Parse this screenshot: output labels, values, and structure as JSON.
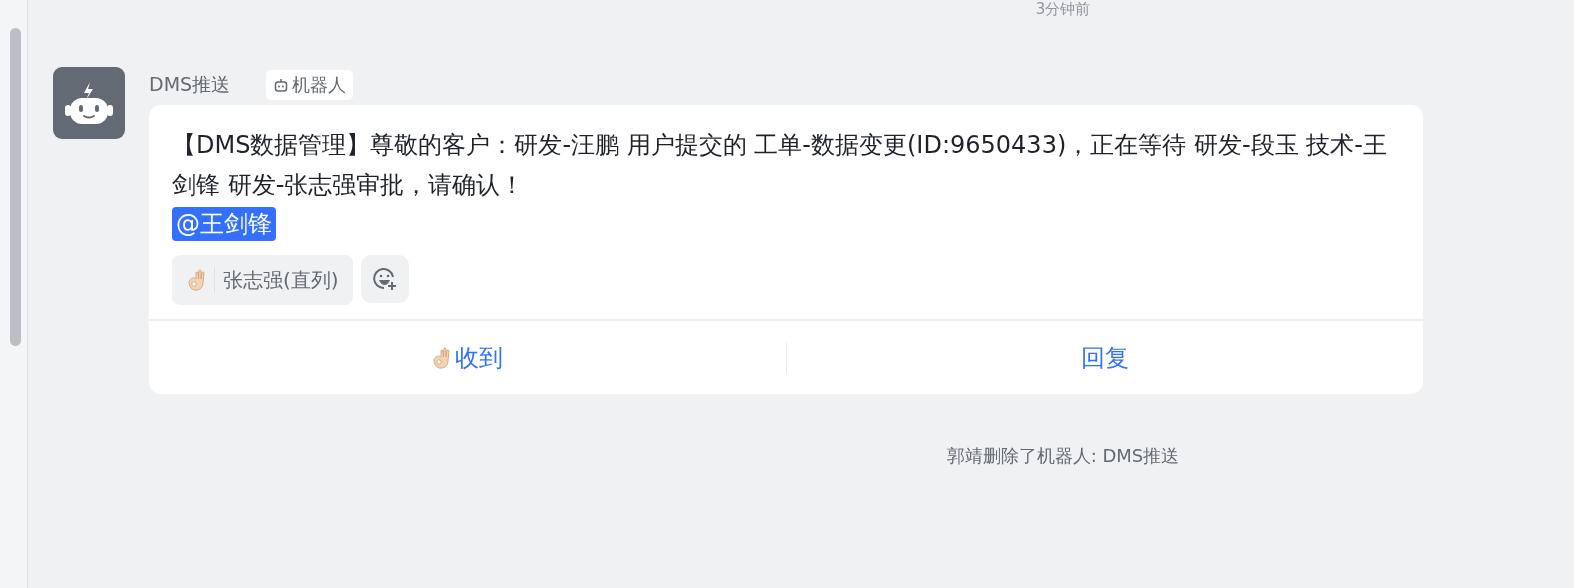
{
  "timestamp": "3分钟前",
  "message": {
    "sender": "DMS推送",
    "sender_tag": "机器人",
    "text": "【DMS数据管理】尊敬的客户：研发-汪鹏 用户提交的 工单-数据变更(ID:9650433)，正在等待 研发-段玉 技术-王剑锋 研发-张志强审批，请确认！",
    "mention": "@王剑锋",
    "reactions": [
      {
        "users": "张志强(直列)"
      }
    ],
    "actions": [
      {
        "label": "收到",
        "kind": "ok"
      },
      {
        "label": "回复",
        "kind": "plain"
      }
    ]
  },
  "system_notice": "郭靖删除了机器人: DMS推送"
}
